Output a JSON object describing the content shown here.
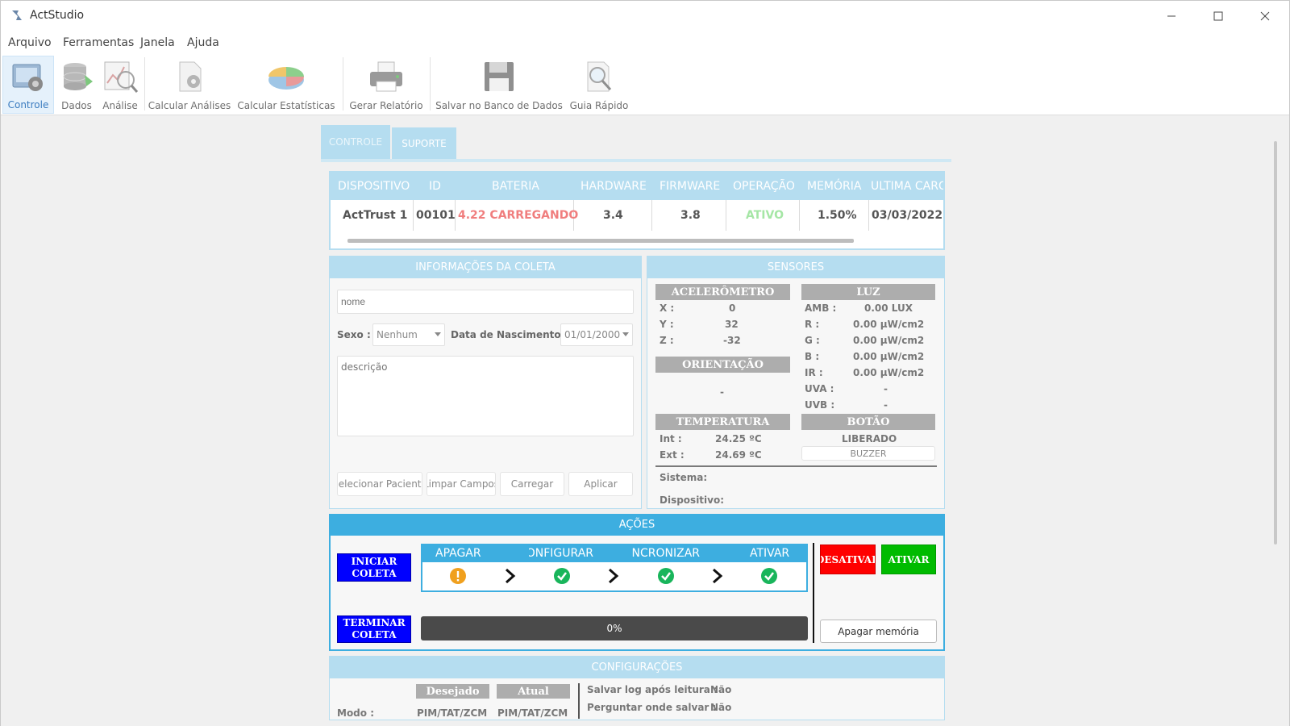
{
  "window": {
    "title": "ActStudio"
  },
  "menu": [
    "Arquivo",
    "Ferramentas",
    "Janela",
    "Ajuda"
  ],
  "toolbar": {
    "controle": "Controle",
    "dados": "Dados",
    "analise": "Análise",
    "calcular_analises": "Calcular Análises",
    "calcular_estatisticas": "Calcular Estatísticas",
    "gerar_relatorio": "Gerar Relatório",
    "salvar_banco": "Salvar no Banco de Dados",
    "guia_rapido": "Guia Rápido"
  },
  "tabs": {
    "controle": "CONTROLE",
    "suporte": "SUPORTE"
  },
  "device_table": {
    "headers": [
      "DISPOSITIVO",
      "ID",
      "BATERIA",
      "HARDWARE",
      "FIRMWARE",
      "OPERAÇÃO",
      "MEMÓRIA",
      "ULTIMA CARG"
    ],
    "row": {
      "dispositivo": "ActTrust 1",
      "id": "00101",
      "bateria": "4.22 CARREGANDO",
      "hardware": "3.4",
      "firmware": "3.8",
      "operacao": "ATIVO",
      "memoria": "1.50%",
      "ultima_carga": "03/03/2022"
    }
  },
  "coleta": {
    "title": "INFORMAÇÕES DA COLETA",
    "nome_placeholder": "nome",
    "sexo_label": "Sexo :",
    "sexo_value": "Nenhum",
    "nascimento_label": "Data de Nascimento :",
    "nascimento_value": "01/01/2000",
    "descricao_placeholder": "descrição",
    "btn_selecionar": "Selecionar Paciente",
    "btn_limpar": "Limpar Campos",
    "btn_carregar": "Carregar",
    "btn_aplicar": "Aplicar"
  },
  "sensores": {
    "title": "SENSORES",
    "acelerometro": {
      "title": "ACELERÔMETRO",
      "x_label": "X :",
      "x": "0",
      "y_label": "Y :",
      "y": "32",
      "z_label": "Z :",
      "z": "-32"
    },
    "orientacao": {
      "title": "ORIENTAÇÃO",
      "value": "-"
    },
    "temperatura": {
      "title": "TEMPERATURA",
      "int_label": "Int :",
      "int": "24.25 ºC",
      "ext_label": "Ext :",
      "ext": "24.69 ºC"
    },
    "luz": {
      "title": "LUZ",
      "amb_label": "AMB :",
      "amb": "0.00 LUX",
      "r_label": "R :",
      "r": "0.00 µW/cm2",
      "g_label": "G :",
      "g": "0.00 µW/cm2",
      "b_label": "B :",
      "b": "0.00 µW/cm2",
      "ir_label": "IR :",
      "ir": "0.00 µW/cm2",
      "uva_label": "UVA :",
      "uva": "-",
      "uvb_label": "UVB :",
      "uvb": "-"
    },
    "botao": {
      "title": "BOTÃO",
      "status": "LIBERADO",
      "buzzer": "BUZZER"
    },
    "sistema_label": "Sistema:",
    "dispositivo_label": "Dispositivo:"
  },
  "acoes": {
    "title": "AÇÕES",
    "iniciar": "INICIAR COLETA",
    "terminar": "TERMINAR COLETA",
    "steps": [
      "APAGAR",
      "CONFIGURAR",
      "SINCRONIZAR",
      "ATIVAR"
    ],
    "progress_text": "0%",
    "progress": 0,
    "btn_desativar": "DESATIVAR",
    "btn_ativar": "ATIVAR",
    "btn_apagar_memoria": "Apagar memória"
  },
  "configuracoes": {
    "title": "CONFIGURAÇÕES",
    "desejado": "Desejado",
    "atual": "Atual",
    "modo_label": "Modo :",
    "modo_desejado": "PIM/TAT/ZCM",
    "modo_atual": "PIM/TAT/ZCM",
    "salvar_log_label": "Salvar log após leitura :",
    "salvar_log": "Não",
    "perguntar_label": "Perguntar onde salvar :",
    "perguntar": "Não"
  },
  "colors": {
    "accent": "#3daee0",
    "header_light": "#b5ddf0",
    "battery": "#f07e7e",
    "active": "#a5e6a5",
    "danger": "#ff0000",
    "success": "#00bb00",
    "primary": "#0000ff"
  }
}
